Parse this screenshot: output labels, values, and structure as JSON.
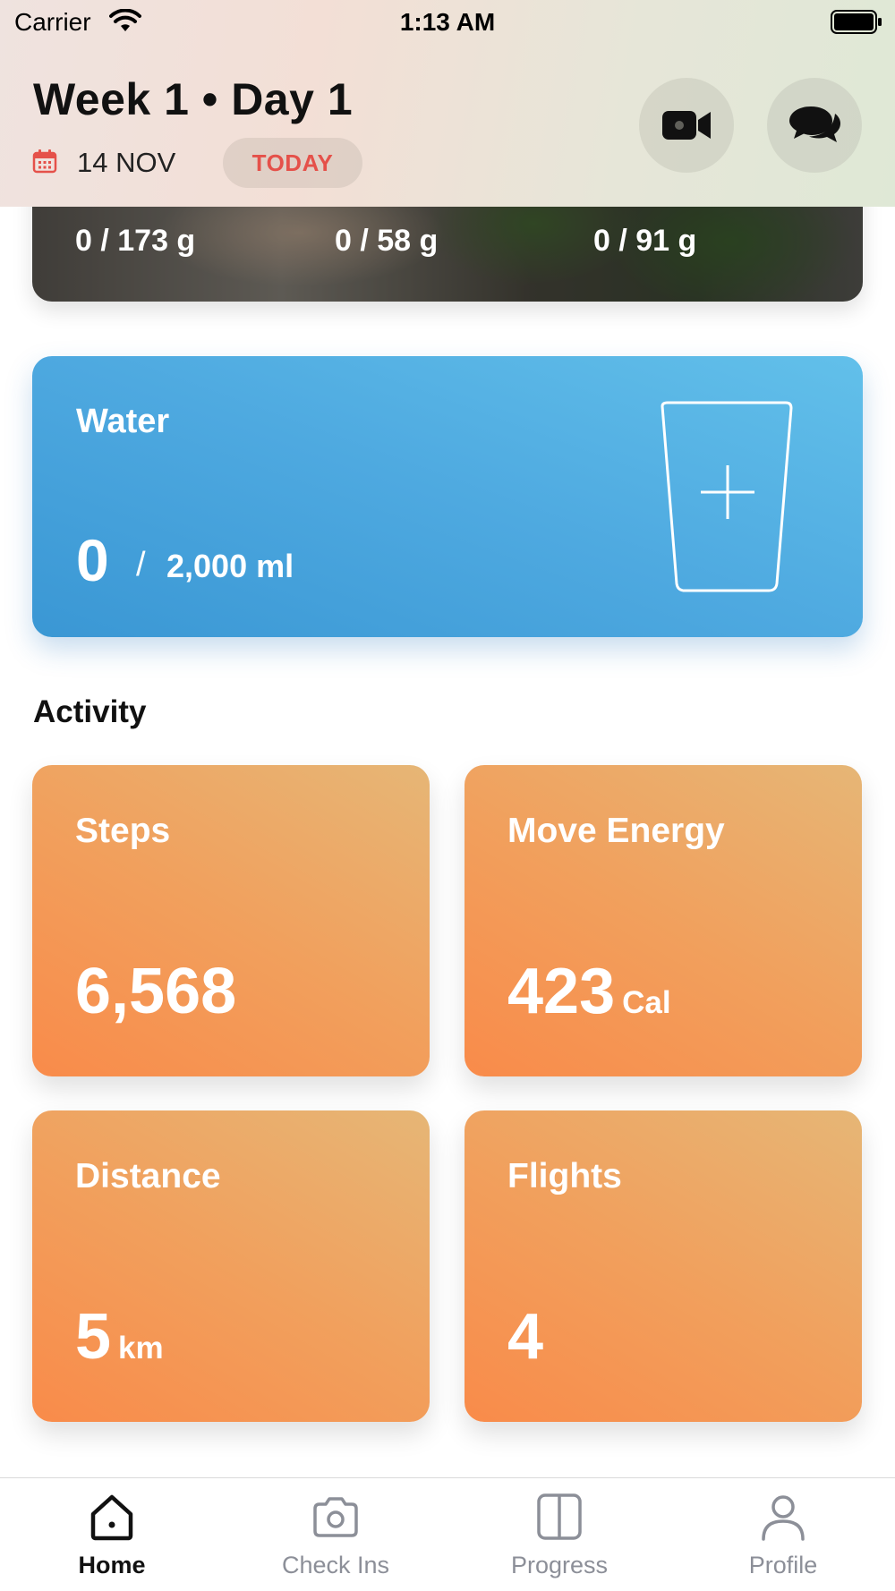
{
  "status_bar": {
    "carrier": "Carrier",
    "time": "1:13 AM"
  },
  "header": {
    "title": "Week 1 • Day 1",
    "date": "14 NOV",
    "today_badge": "TODAY",
    "video_icon": "video-camera-icon",
    "chat_icon": "chat-bubbles-icon"
  },
  "nutrition": {
    "macros": [
      "0 / 173 g",
      "0 / 58 g",
      "0 / 91 g"
    ]
  },
  "water": {
    "title": "Water",
    "current": "0",
    "separator": "/",
    "goal": "2,000 ml",
    "add_icon": "glass-plus-icon"
  },
  "activity": {
    "heading": "Activity",
    "steps": {
      "label": "Steps",
      "value": "6,568",
      "unit": ""
    },
    "move_energy": {
      "label": "Move Energy",
      "value": "423",
      "unit": "Cal"
    },
    "distance": {
      "label": "Distance",
      "value": "5",
      "unit": "km"
    },
    "flights": {
      "label": "Flights",
      "value": "4",
      "unit": ""
    }
  },
  "tabs": [
    {
      "label": "Home",
      "icon": "home-icon",
      "active": true
    },
    {
      "label": "Check Ins",
      "icon": "camera-icon",
      "active": false
    },
    {
      "label": "Progress",
      "icon": "split-panel-icon",
      "active": false
    },
    {
      "label": "Profile",
      "icon": "person-icon",
      "active": false
    }
  ],
  "colors": {
    "today_text": "#e5514a",
    "water_gradient": [
      "#3a97d4",
      "#62c0ea"
    ],
    "activity_gradient": [
      "#f98b4a",
      "#e6b676"
    ],
    "tab_inactive": "#8c8f98"
  }
}
